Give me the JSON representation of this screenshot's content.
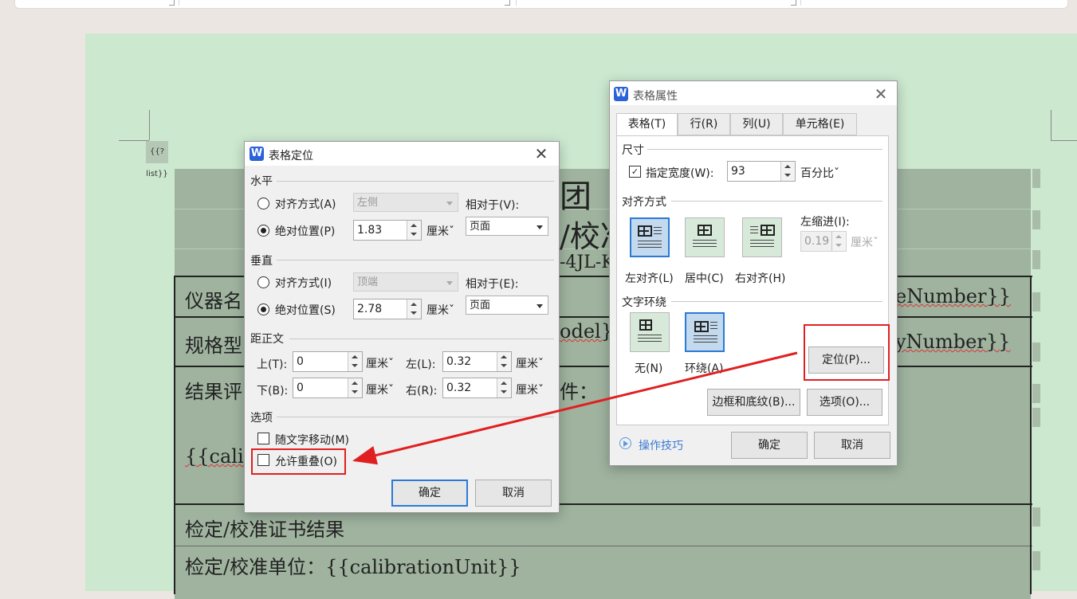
{
  "document": {
    "list_placeholder": "{{?list}}",
    "title_line1_fragment": "团 （",
    "title_line2_fragment": "/校准",
    "code_fragment": "-4JL-K",
    "row1_label": "仪器名",
    "row1_right": "eNumber}}",
    "row2_label": "规格型",
    "row2_mid": "odel}",
    "row2_right": "yNumber}}",
    "row3_label": "结果评",
    "row3_mid": "件：",
    "calib_fragment": "{{calib",
    "cert_result": "检定/校准证书结果",
    "calib_unit": "检定/校准单位：{{calibrationUnit}}"
  },
  "positioning_dialog": {
    "title": "表格定位",
    "horizontal_section": "水平",
    "align_label": "对方式(A)",
    "align_label_full": "对齐方式(A)",
    "align_value": "左侧",
    "relative_to_label": "相对于(V):",
    "abs_pos_label": "绝对位置(P)",
    "abs_pos_h_value": "1.83",
    "unit": "厘米",
    "relative_h_value": "页面",
    "vertical_section": "垂直",
    "v_align_label": "对齐方式(I)",
    "v_align_value": "顶端",
    "v_relative_to_label": "相对于(E):",
    "v_abs_pos_label": "绝对位置(S)",
    "abs_pos_v_value": "2.78",
    "relative_v_value": "页面",
    "distance_section": "距正文",
    "top_label": "上(T):",
    "top_value": "0",
    "left_label": "左(L):",
    "left_value": "0.32",
    "bottom_label": "下(B):",
    "bottom_value": "0",
    "right_label": "右(R):",
    "right_value": "0.32",
    "options_section": "选项",
    "move_with_text": "随文字移动(M)",
    "allow_overlap": "允许重叠(O)",
    "ok": "确定",
    "cancel": "取消"
  },
  "table_props_dialog": {
    "title": "表格属性",
    "tabs": [
      "表格(T)",
      "行(R)",
      "列(U)",
      "单元格(E)"
    ],
    "size_section": "尺寸",
    "width_label": "指定宽度(W):",
    "width_value": "93",
    "width_unit": "百分比",
    "alignment_section": "对齐方式",
    "align_left": "左对齐(L)",
    "align_center": "居中(C)",
    "align_right": "右对齐(H)",
    "indent_label": "左缩进(I):",
    "indent_value": "0.19",
    "indent_unit": "厘米",
    "wrap_section": "文字环绕",
    "wrap_none": "无(N)",
    "wrap_around": "环绕(A)",
    "position_button": "定位(P)...",
    "borders_button": "边框和底纹(B)...",
    "options_button": "选项(O)...",
    "tips": "操作技巧",
    "ok": "确定",
    "cancel": "取消"
  },
  "colors": {
    "page_bg": "#cce8cf",
    "highlight_red": "#e02020",
    "primary_blue": "#2a7ad6",
    "wps_logo": "#2a62d8"
  }
}
